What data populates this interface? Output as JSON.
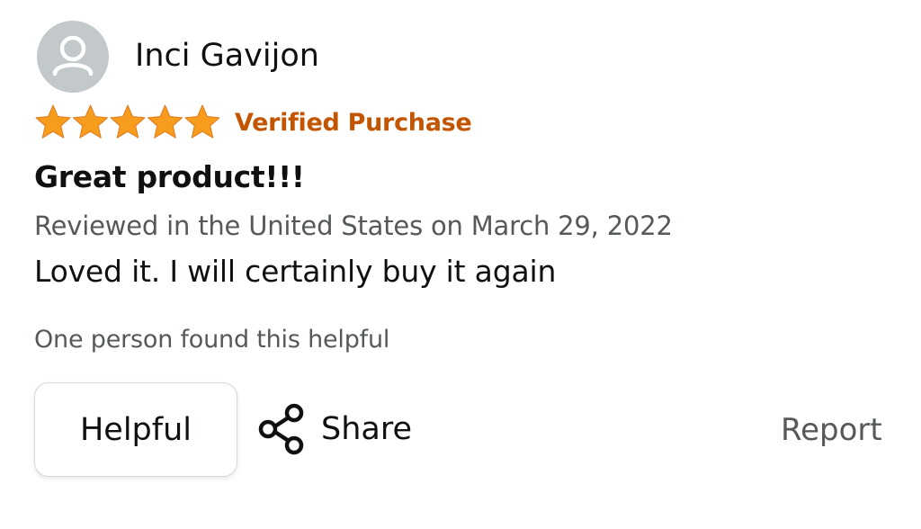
{
  "review": {
    "reviewer_name": "Inci Gavijon",
    "avatar_icon": "user-silhouette-icon",
    "rating": {
      "value": 5,
      "max": 5,
      "star_color": "#f79c1d"
    },
    "verified_label": "Verified Purchase",
    "title": "Great product!!!",
    "date": "Reviewed in the United States on March 29, 2022",
    "body": "Loved it. I will certainly buy it again",
    "helpful_count": "One person found this helpful"
  },
  "actions": {
    "helpful_label": "Helpful",
    "share_label": "Share",
    "share_icon": "share-icon",
    "report_label": "Report"
  },
  "colors": {
    "verified": "#c45500",
    "secondary_text": "#565959",
    "primary_text": "#0f1111",
    "avatar_bg": "#c3c8ca"
  }
}
